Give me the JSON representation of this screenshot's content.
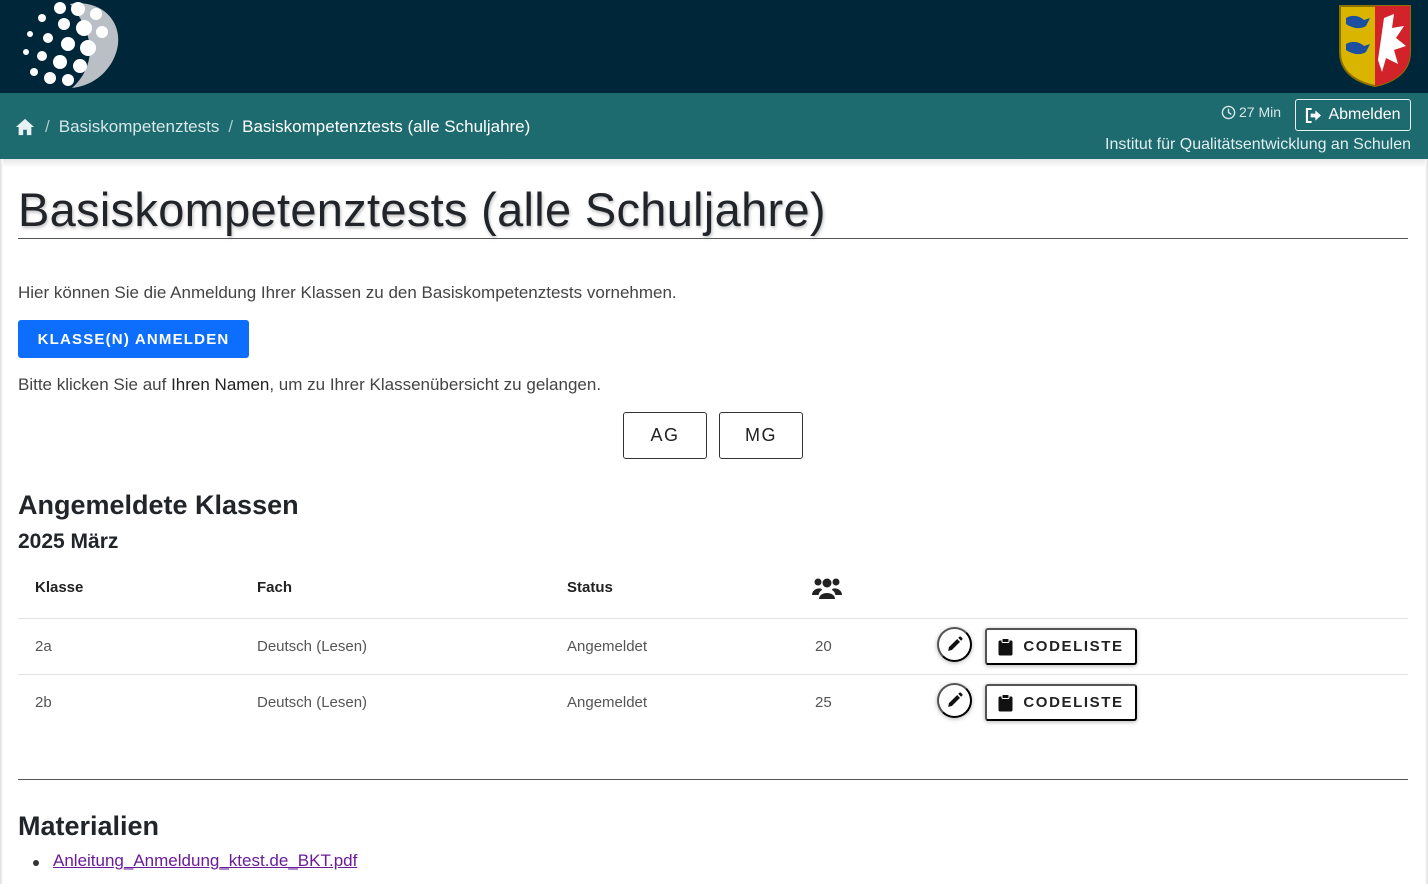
{
  "breadcrumb": {
    "items": [
      {
        "label": "Basiskompetenztests"
      },
      {
        "label": "Basiskompetenztests (alle Schuljahre)"
      }
    ],
    "separator": "/"
  },
  "header": {
    "timer": "27 Min",
    "logout_label": "Abmelden",
    "institute": "Institut für Qualitätsentwicklung an Schulen"
  },
  "page": {
    "title": "Basiskompetenztests (alle Schuljahre)",
    "intro": "Hier können Sie die Anmeldung Ihrer Klassen zu den Basiskompetenztests vornehmen.",
    "register_button": "KLASSE(N) ANMELDEN",
    "hint_before": "Bitte klicken Sie auf ",
    "hint_bold": "Ihren Namen",
    "hint_after": ", um zu Ihrer Klassenübersicht zu gelangen.",
    "name_buttons": [
      "AG",
      "MG"
    ]
  },
  "registered": {
    "heading": "Angemeldete Klassen",
    "period": "2025 März",
    "columns": [
      "Klasse",
      "Fach",
      "Status"
    ],
    "rows": [
      {
        "klasse": "2a",
        "fach": "Deutsch (Lesen)",
        "status": "Angemeldet",
        "count": "20",
        "codelist_label": "CODELISTE"
      },
      {
        "klasse": "2b",
        "fach": "Deutsch (Lesen)",
        "status": "Angemeldet",
        "count": "25",
        "codelist_label": "CODELISTE"
      }
    ]
  },
  "materials": {
    "heading": "Materialien",
    "items": [
      "Anleitung_Anmeldung_ktest.de_BKT.pdf"
    ]
  },
  "icons": {
    "logo": "dot-sphere-logo",
    "coat_of_arms": "coat-of-arms-icon",
    "home": "home-icon",
    "clock": "clock-icon",
    "logout": "logout-icon",
    "people": "people-group-icon",
    "edit": "pencil-icon",
    "clipboard": "clipboard-icon"
  },
  "colors": {
    "topbar": "#00263a",
    "crumbbar": "#1d6a6f",
    "primary": "#0d6efd",
    "link_visited": "#6a1b9a"
  }
}
